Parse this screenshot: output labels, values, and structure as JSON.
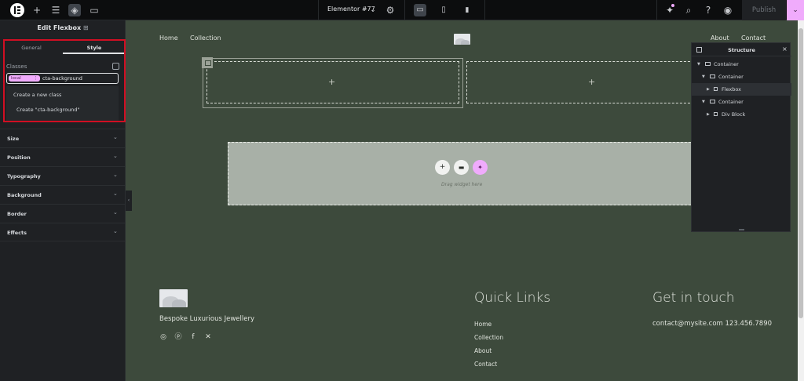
{
  "topbar": {
    "doc_title": "Elementor #77",
    "publish_label": "Publish"
  },
  "panel": {
    "title": "Edit Flexbox",
    "tabs": [
      "General",
      "Style"
    ],
    "active_tab": "Style",
    "classes_label": "Classes",
    "chip_label": "local",
    "class_input_value": "cta-background",
    "dropdown": [
      "Create a new class",
      "Create \"cta-background\""
    ],
    "sections": [
      "Size",
      "Position",
      "Typography",
      "Background",
      "Border",
      "Effects"
    ]
  },
  "site": {
    "nav_left": [
      "Home",
      "Collection"
    ],
    "nav_right": [
      "About",
      "Contact"
    ],
    "drag_text": "Drag widget here"
  },
  "structure": {
    "title": "Structure",
    "items": [
      {
        "label": "Container",
        "level": 0,
        "expanded": true
      },
      {
        "label": "Container",
        "level": 1,
        "expanded": true
      },
      {
        "label": "Flexbox",
        "level": 2,
        "expanded": false,
        "selected": true
      },
      {
        "label": "Container",
        "level": 1,
        "expanded": true
      },
      {
        "label": "Div Block",
        "level": 2,
        "expanded": false
      }
    ]
  },
  "footer": {
    "tagline": "Bespoke Luxurious Jewellery",
    "quick_links_heading": "Quick Links",
    "quick_links": [
      "Home",
      "Collection",
      "About",
      "Contact"
    ],
    "contact_heading": "Get in touch",
    "contact_text": "contact@mysite.com 123.456.7890",
    "social_icons": [
      "instagram-icon",
      "pinterest-icon",
      "facebook-icon",
      "x-icon"
    ]
  },
  "colors": {
    "canvas": "#3d4a3c",
    "panel": "#1f2124",
    "accent": "#f0abfc",
    "highlight": "#d10f23"
  }
}
